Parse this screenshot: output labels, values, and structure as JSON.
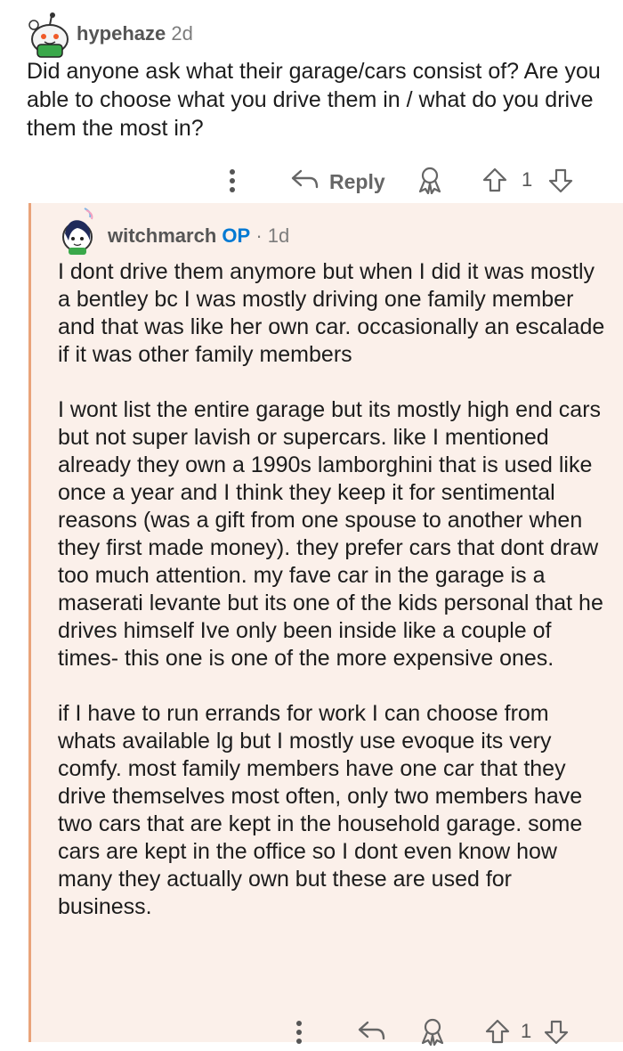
{
  "parent_comment": {
    "username": "hypehaze",
    "age": "2d",
    "body": "Did anyone ask what their garage/cars consist of? Are you able to choose what you drive them in / what do you drive them the most in?",
    "reply_label": "Reply",
    "score": "1"
  },
  "reply_comment": {
    "username": "witchmarch",
    "op_badge": "OP",
    "separator": "·",
    "age": "1d",
    "paragraphs": [
      "I dont drive them anymore but when I did it was mostly a bentley bc I was mostly driving one family member and that was like her own car. occasionally an escalade if it was other family members",
      "I wont list the entire garage but its mostly high end cars but not super lavish or supercars. like I mentioned already they own a 1990s lamborghini that is used like once a year and I think they keep it for sentimental reasons (was a gift from one spouse to another when they first made money). they prefer cars that dont draw too much attention. my fave car in the garage is a maserati levante but its one of the kids personal that he drives himself Ive only been inside like a couple of times- this one is one of the more expensive ones.",
      "if I have to run errands for work I can choose from whats available lg but I mostly use evoque its very comfy. most family members have one car that they drive themselves most often, only two members have two cars that are kept in the household garage. some cars are kept in the office so I dont even know how many they actually own but these are used for business."
    ],
    "score": "1"
  },
  "colors": {
    "thread_line": "#e9a37a",
    "reply_background": "#fbf0ea",
    "op_blue": "#0079d3",
    "icon_gray": "#6f6f6f"
  }
}
